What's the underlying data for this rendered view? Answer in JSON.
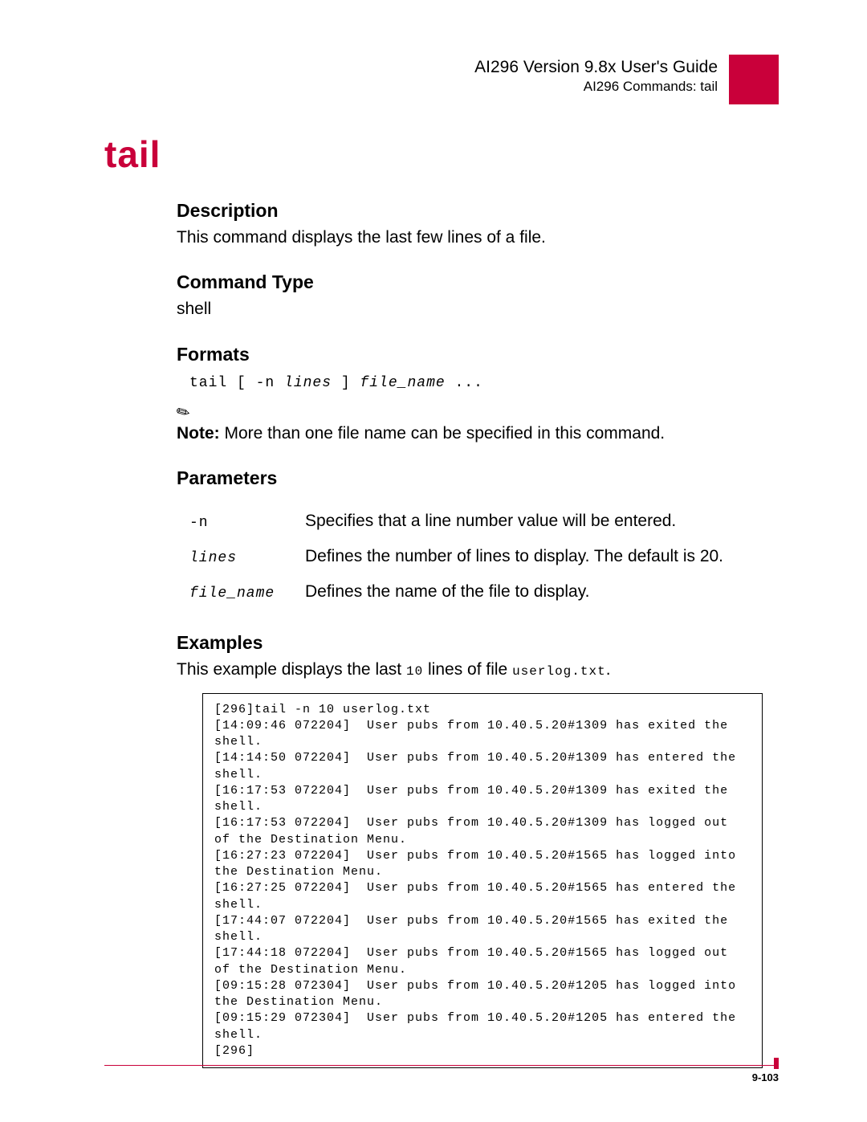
{
  "header": {
    "title": "AI296 Version 9.8x User's Guide",
    "subtitle": "AI296 Commands: tail"
  },
  "command_title": "tail",
  "sections": {
    "description": {
      "heading": "Description",
      "text": "This command displays the last few lines of a file."
    },
    "command_type": {
      "heading": "Command Type",
      "text": "shell"
    },
    "formats": {
      "heading": "Formats",
      "cmd_prefix": "tail [ -n ",
      "arg1": "lines",
      "mid": " ] ",
      "arg2": "file_name",
      "suffix": " ..."
    },
    "note": {
      "label": "Note:",
      "text": "  More than one file name can be specified in this command."
    },
    "parameters": {
      "heading": "Parameters",
      "rows": [
        {
          "name": "-n",
          "italic": false,
          "desc": "Specifies that a line number value will be entered."
        },
        {
          "name": "lines",
          "italic": true,
          "desc": "Defines the number of lines to display. The default is 20."
        },
        {
          "name": "file_name",
          "italic": true,
          "desc": "Defines the name of the file to display."
        }
      ]
    },
    "examples": {
      "heading": "Examples",
      "intro_a": "This example displays the last ",
      "intro_code1": "10",
      "intro_b": " lines of file ",
      "intro_code2": "userlog.txt",
      "intro_c": ".",
      "output": "[296]tail -n 10 userlog.txt\n[14:09:46 072204]  User pubs from 10.40.5.20#1309 has exited the shell.\n[14:14:50 072204]  User pubs from 10.40.5.20#1309 has entered the shell.\n[16:17:53 072204]  User pubs from 10.40.5.20#1309 has exited the shell.\n[16:17:53 072204]  User pubs from 10.40.5.20#1309 has logged out of the Destination Menu.\n[16:27:23 072204]  User pubs from 10.40.5.20#1565 has logged into the Destination Menu.\n[16:27:25 072204]  User pubs from 10.40.5.20#1565 has entered the shell.\n[17:44:07 072204]  User pubs from 10.40.5.20#1565 has exited the shell.\n[17:44:18 072204]  User pubs from 10.40.5.20#1565 has logged out of the Destination Menu.\n[09:15:28 072304]  User pubs from 10.40.5.20#1205 has logged into the Destination Menu.\n[09:15:29 072304]  User pubs from 10.40.5.20#1205 has entered the shell.\n[296]"
    }
  },
  "footer": {
    "page": "9-103"
  }
}
